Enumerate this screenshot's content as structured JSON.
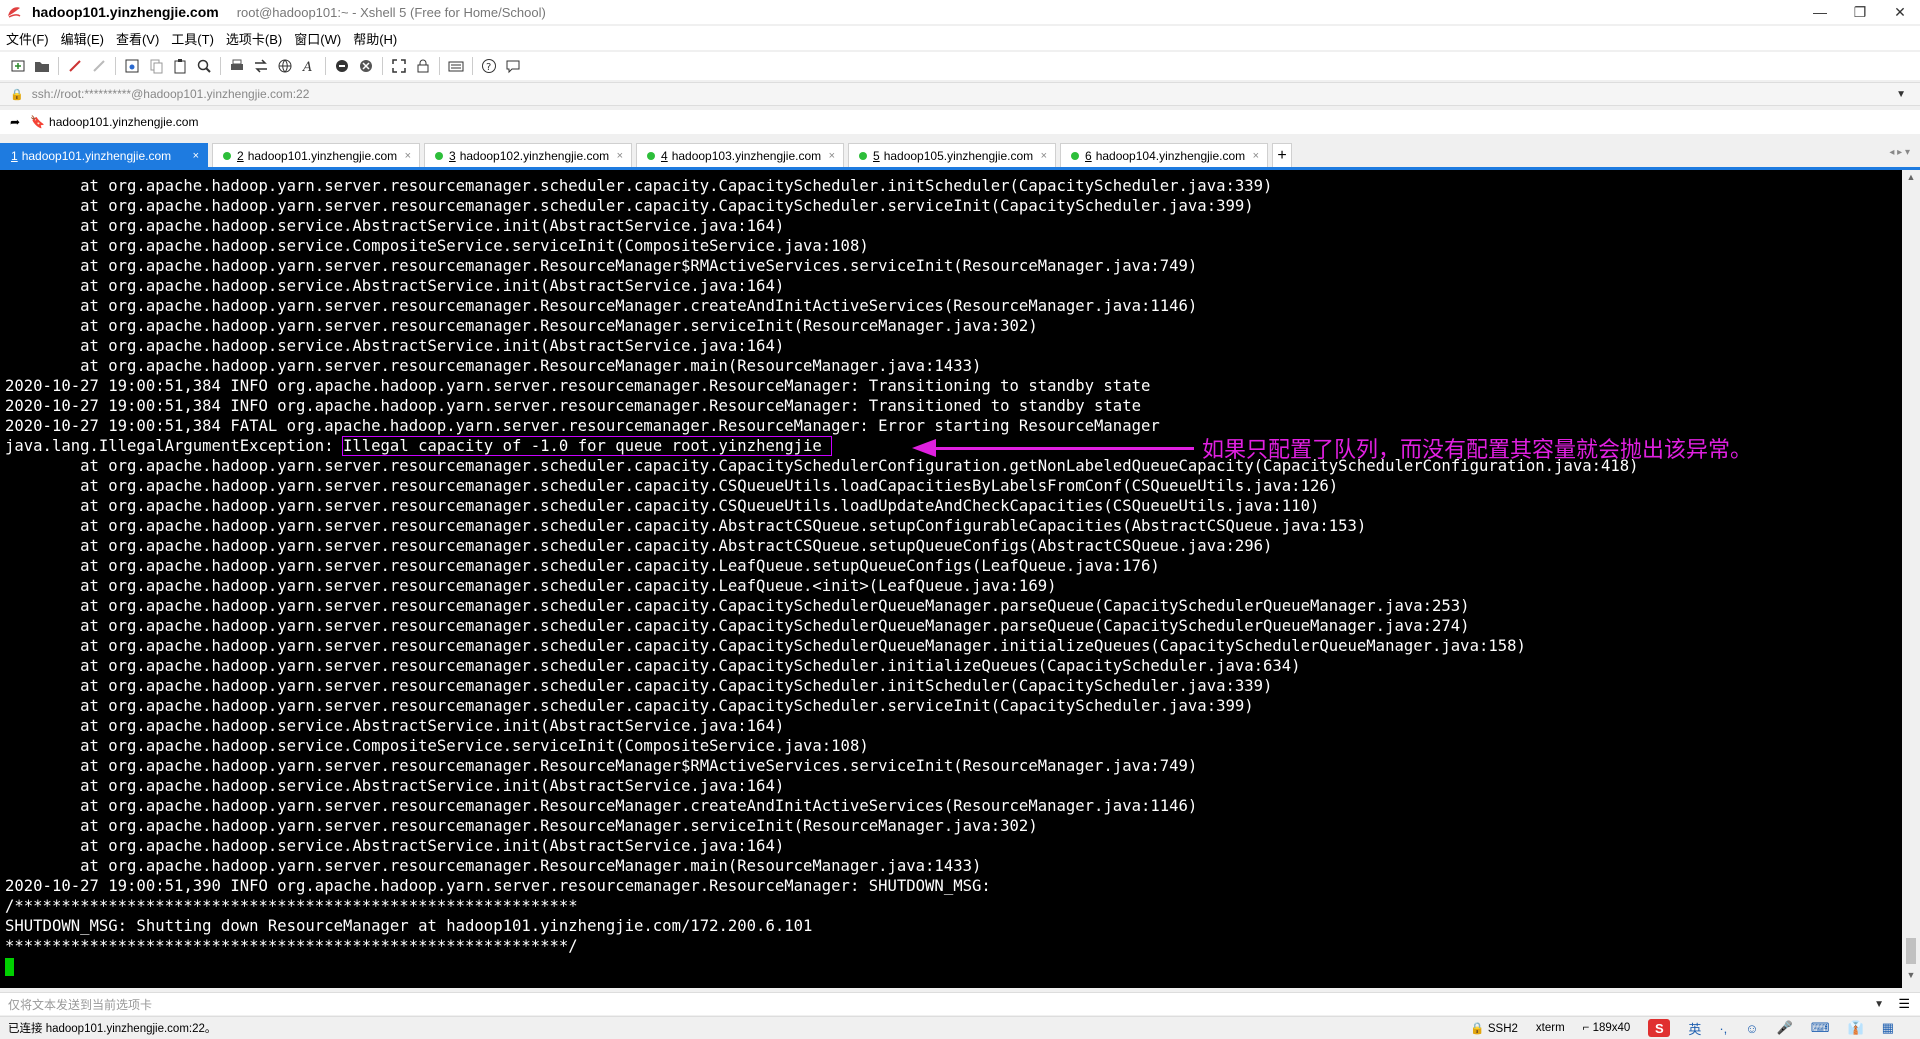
{
  "window": {
    "title_main": "hadoop101.yinzhengjie.com",
    "title_sub": "root@hadoop101:~ - Xshell 5 (Free for Home/School)",
    "controls": {
      "minimize": "—",
      "restore": "❐",
      "close": "✕"
    }
  },
  "menu": [
    "文件(F)",
    "编辑(E)",
    "查看(V)",
    "工具(T)",
    "选项卡(B)",
    "窗口(W)",
    "帮助(H)"
  ],
  "address": {
    "value": "ssh://root:**********@hadoop101.yinzhengjie.com:22",
    "lock_icon": "🔒",
    "dropdown_icon": "▼"
  },
  "links": {
    "arrow_icon": "➦",
    "bookmark_icon": "🔖",
    "item": "hadoop101.yinzhengjie.com"
  },
  "tabs": [
    {
      "num": "1",
      "label": "hadoop101.yinzhengjie.com",
      "active": true
    },
    {
      "num": "2",
      "label": "hadoop101.yinzhengjie.com",
      "active": false
    },
    {
      "num": "3",
      "label": "hadoop102.yinzhengjie.com",
      "active": false
    },
    {
      "num": "4",
      "label": "hadoop103.yinzhengjie.com",
      "active": false
    },
    {
      "num": "5",
      "label": "hadoop105.yinzhengjie.com",
      "active": false
    },
    {
      "num": "6",
      "label": "hadoop104.yinzhengjie.com",
      "active": false
    }
  ],
  "tab_close": "×",
  "tab_add": "+",
  "tab_nav": "◂ ▸ ▾",
  "terminal": {
    "lines": [
      "        at org.apache.hadoop.yarn.server.resourcemanager.scheduler.capacity.CapacityScheduler.initScheduler(CapacityScheduler.java:339)",
      "        at org.apache.hadoop.yarn.server.resourcemanager.scheduler.capacity.CapacityScheduler.serviceInit(CapacityScheduler.java:399)",
      "        at org.apache.hadoop.service.AbstractService.init(AbstractService.java:164)",
      "        at org.apache.hadoop.service.CompositeService.serviceInit(CompositeService.java:108)",
      "        at org.apache.hadoop.yarn.server.resourcemanager.ResourceManager$RMActiveServices.serviceInit(ResourceManager.java:749)",
      "        at org.apache.hadoop.service.AbstractService.init(AbstractService.java:164)",
      "        at org.apache.hadoop.yarn.server.resourcemanager.ResourceManager.createAndInitActiveServices(ResourceManager.java:1146)",
      "        at org.apache.hadoop.yarn.server.resourcemanager.ResourceManager.serviceInit(ResourceManager.java:302)",
      "        at org.apache.hadoop.service.AbstractService.init(AbstractService.java:164)",
      "        at org.apache.hadoop.yarn.server.resourcemanager.ResourceManager.main(ResourceManager.java:1433)",
      "2020-10-27 19:00:51,384 INFO org.apache.hadoop.yarn.server.resourcemanager.ResourceManager: Transitioning to standby state",
      "2020-10-27 19:00:51,384 INFO org.apache.hadoop.yarn.server.resourcemanager.ResourceManager: Transitioned to standby state",
      "2020-10-27 19:00:51,384 FATAL org.apache.hadoop.yarn.server.resourcemanager.ResourceManager: Error starting ResourceManager",
      {
        "prefix": "java.lang.IllegalArgumentException: ",
        "highlight": "Illegal capacity of -1.0 for queue root.yinzhengjie "
      },
      "        at org.apache.hadoop.yarn.server.resourcemanager.scheduler.capacity.CapacitySchedulerConfiguration.getNonLabeledQueueCapacity(CapacitySchedulerConfiguration.java:418)",
      "        at org.apache.hadoop.yarn.server.resourcemanager.scheduler.capacity.CSQueueUtils.loadCapacitiesByLabelsFromConf(CSQueueUtils.java:126)",
      "        at org.apache.hadoop.yarn.server.resourcemanager.scheduler.capacity.CSQueueUtils.loadUpdateAndCheckCapacities(CSQueueUtils.java:110)",
      "        at org.apache.hadoop.yarn.server.resourcemanager.scheduler.capacity.AbstractCSQueue.setupConfigurableCapacities(AbstractCSQueue.java:153)",
      "        at org.apache.hadoop.yarn.server.resourcemanager.scheduler.capacity.AbstractCSQueue.setupQueueConfigs(AbstractCSQueue.java:296)",
      "        at org.apache.hadoop.yarn.server.resourcemanager.scheduler.capacity.LeafQueue.setupQueueConfigs(LeafQueue.java:176)",
      "        at org.apache.hadoop.yarn.server.resourcemanager.scheduler.capacity.LeafQueue.<init>(LeafQueue.java:169)",
      "        at org.apache.hadoop.yarn.server.resourcemanager.scheduler.capacity.CapacitySchedulerQueueManager.parseQueue(CapacitySchedulerQueueManager.java:253)",
      "        at org.apache.hadoop.yarn.server.resourcemanager.scheduler.capacity.CapacitySchedulerQueueManager.parseQueue(CapacitySchedulerQueueManager.java:274)",
      "        at org.apache.hadoop.yarn.server.resourcemanager.scheduler.capacity.CapacitySchedulerQueueManager.initializeQueues(CapacitySchedulerQueueManager.java:158)",
      "        at org.apache.hadoop.yarn.server.resourcemanager.scheduler.capacity.CapacityScheduler.initializeQueues(CapacityScheduler.java:634)",
      "        at org.apache.hadoop.yarn.server.resourcemanager.scheduler.capacity.CapacityScheduler.initScheduler(CapacityScheduler.java:339)",
      "        at org.apache.hadoop.yarn.server.resourcemanager.scheduler.capacity.CapacityScheduler.serviceInit(CapacityScheduler.java:399)",
      "        at org.apache.hadoop.service.AbstractService.init(AbstractService.java:164)",
      "        at org.apache.hadoop.service.CompositeService.serviceInit(CompositeService.java:108)",
      "        at org.apache.hadoop.yarn.server.resourcemanager.ResourceManager$RMActiveServices.serviceInit(ResourceManager.java:749)",
      "        at org.apache.hadoop.service.AbstractService.init(AbstractService.java:164)",
      "        at org.apache.hadoop.yarn.server.resourcemanager.ResourceManager.createAndInitActiveServices(ResourceManager.java:1146)",
      "        at org.apache.hadoop.yarn.server.resourcemanager.ResourceManager.serviceInit(ResourceManager.java:302)",
      "        at org.apache.hadoop.service.AbstractService.init(AbstractService.java:164)",
      "        at org.apache.hadoop.yarn.server.resourcemanager.ResourceManager.main(ResourceManager.java:1433)",
      "2020-10-27 19:00:51,390 INFO org.apache.hadoop.yarn.server.resourcemanager.ResourceManager: SHUTDOWN_MSG:",
      "/************************************************************",
      "SHUTDOWN_MSG: Shutting down ResourceManager at hadoop101.yinzhengjie.com/172.200.6.101",
      "************************************************************/",
      {
        "cursor": true
      }
    ],
    "annotation": "如果只配置了队列，而没有配置其容量就会抛出该异常。",
    "colors": {
      "text": "#ffffff",
      "background": "#000000",
      "highlight_box": "#c800ff",
      "annotation": "#e020e0",
      "cursor": "#00d000"
    }
  },
  "sendbar": {
    "placeholder": "仅将文本发送到当前选项卡",
    "dropdown_icon": "▼",
    "menu_icon": "☰"
  },
  "status": {
    "connection": "已连接 hadoop101.yinzhengjie.com:22。",
    "protocol": "🔒 SSH2",
    "term": "xterm",
    "size": "⌐ 189x40",
    "ime": [
      "S",
      "英",
      "·,",
      "☺",
      "🎤",
      "⌨",
      "👔",
      "▦"
    ]
  }
}
